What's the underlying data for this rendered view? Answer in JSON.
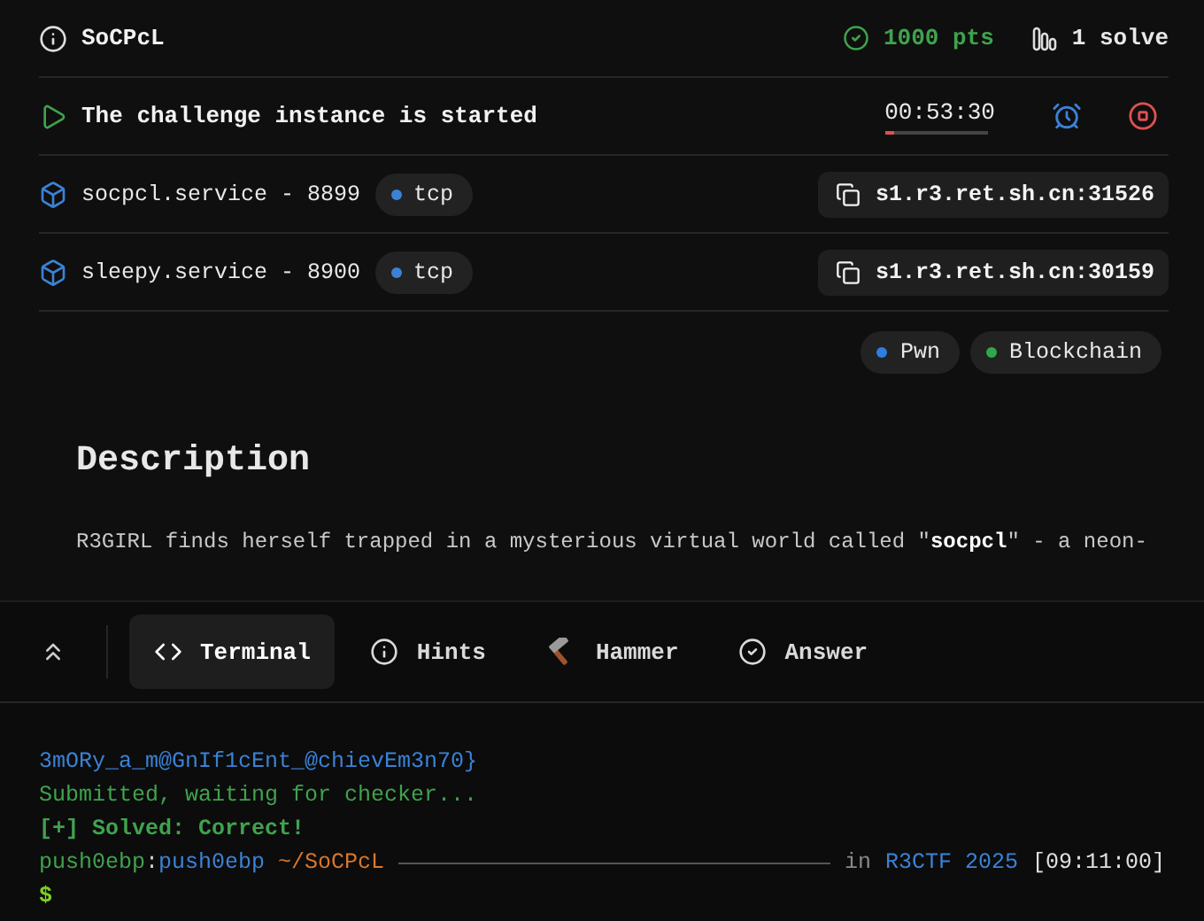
{
  "challenge": {
    "title": "SoCPcL",
    "points": "1000 pts",
    "solves": "1 solve"
  },
  "instance": {
    "status": "The challenge instance is started",
    "timer": "00:53:30",
    "level": 0.1
  },
  "services": [
    {
      "name": "socpcl.service - 8899",
      "protocol": "tcp",
      "address": "s1.r3.ret.sh.cn:31526"
    },
    {
      "name": "sleepy.service - 8900",
      "protocol": "tcp",
      "address": "s1.r3.ret.sh.cn:30159"
    }
  ],
  "tags": [
    {
      "label": "Pwn",
      "color": "#2f7de0"
    },
    {
      "label": "Blockchain",
      "color": "#2fa84a"
    }
  ],
  "description": {
    "heading": "Description",
    "text": "R3GIRL finds herself trapped in a mysterious virtual world called \"**socpcl**\" - a neon-"
  },
  "tabs": [
    {
      "label": "Terminal",
      "kind": "code",
      "selected": true
    },
    {
      "label": "Hints",
      "kind": "info",
      "selected": false
    },
    {
      "label": "Hammer",
      "kind": "hammer",
      "selected": false
    },
    {
      "label": "Answer",
      "kind": "check",
      "selected": false
    }
  ],
  "terminal": {
    "lines": [
      {
        "kind": "plain",
        "bold": false,
        "segments": [
          {
            "text": "3mORy_a_m@GnIf1cEnt_@chievEm3n70}",
            "color": "#3b82d6"
          }
        ]
      },
      {
        "kind": "plain",
        "bold": false,
        "segments": [
          {
            "text": "Submitted, waiting for checker...",
            "color": "#3fa34d"
          }
        ]
      },
      {
        "kind": "plain",
        "bold": true,
        "segments": [
          {
            "text": "[+] Solved: Correct!",
            "color": "#3fa34d"
          }
        ]
      },
      {
        "kind": "status",
        "bold": false,
        "segments": [
          {
            "text": "push0ebp",
            "color": "#3fa34d"
          },
          {
            "text": ":",
            "color": "#d0d0d0"
          },
          {
            "text": "push0ebp",
            "color": "#3b82d6"
          },
          {
            "text": " ~/SoCPcL",
            "color": "#d9772b"
          }
        ],
        "right": [
          {
            "text": "in",
            "color": "#8a8a8a"
          },
          {
            "text": "R3CTF 2025",
            "color": "#3b82d6"
          },
          {
            "text": "[09:11:00]",
            "color": "#e0e0e0"
          }
        ]
      },
      {
        "kind": "prompt",
        "bold": true,
        "segments": [
          {
            "text": "$",
            "color": "#7ed321"
          }
        ]
      }
    ]
  }
}
